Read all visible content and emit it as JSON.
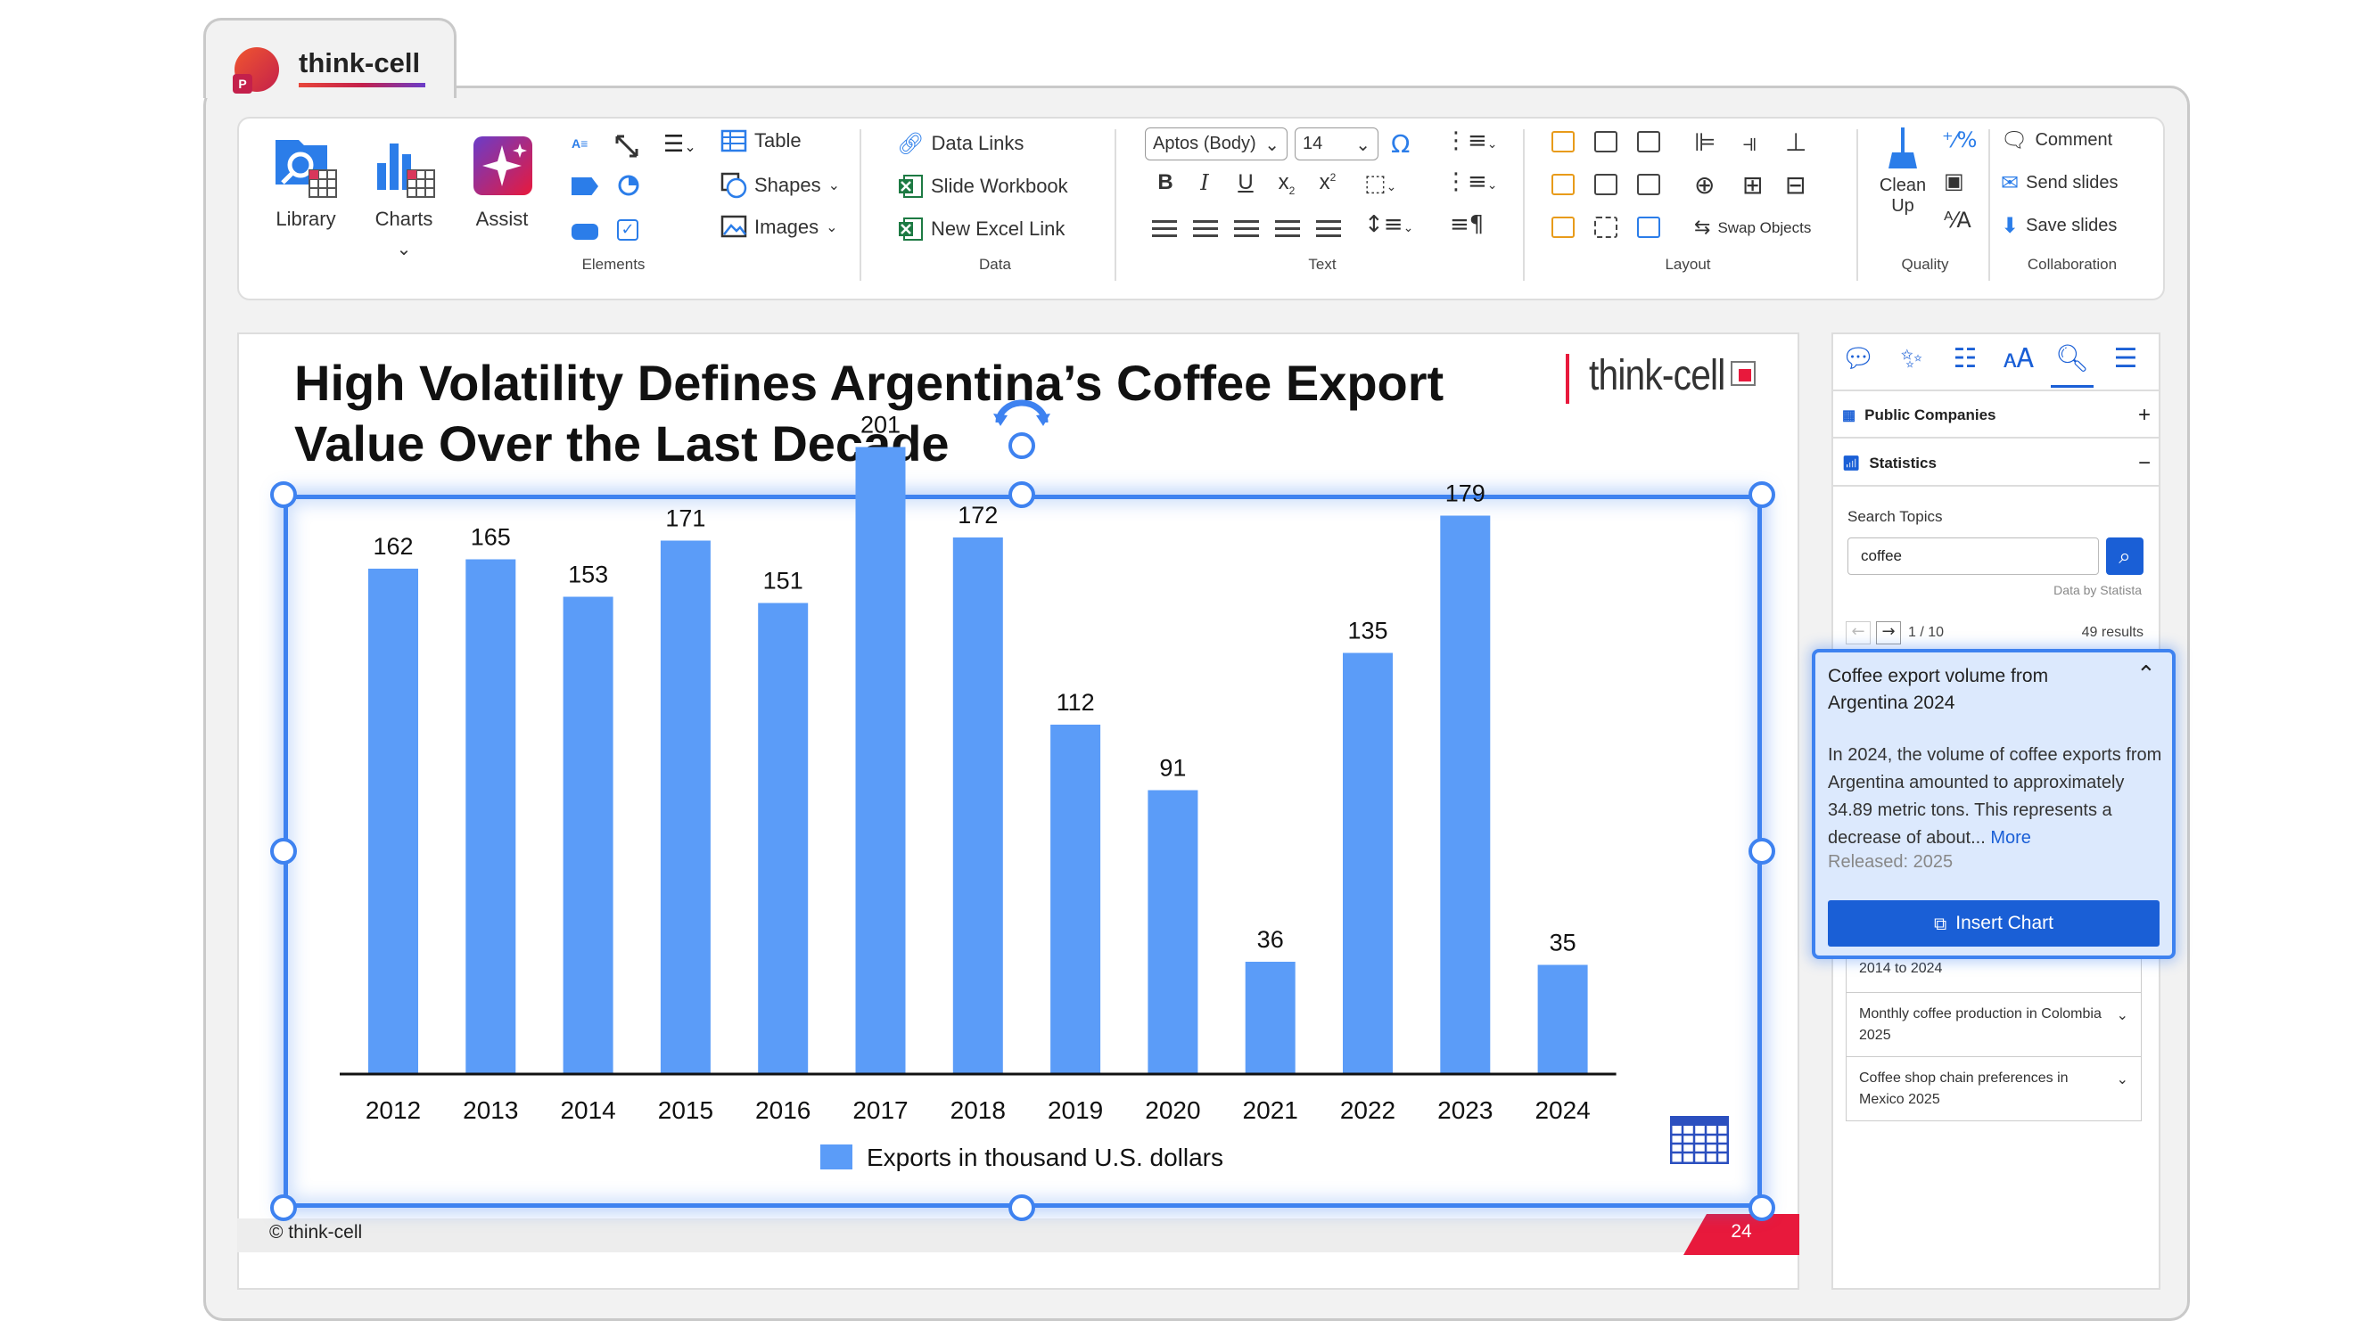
{
  "app": {
    "name": "think-cell"
  },
  "ribbon": {
    "library": "Library",
    "charts": "Charts",
    "assist": "Assist",
    "groups": {
      "elements": "Elements",
      "data": "Data",
      "text": "Text",
      "layout": "Layout",
      "quality": "Quality",
      "collaboration": "Collaboration"
    },
    "table": "Table",
    "shapes": "Shapes",
    "images": "Images",
    "data_links": "Data Links",
    "slide_workbook": "Slide Workbook",
    "new_excel_link": "New Excel Link",
    "font_name": "Aptos (Body)",
    "font_size": "14",
    "swap_objects": "Swap Objects",
    "clean_up": "Clean\nUp",
    "clean": "Clean",
    "up": "Up",
    "comment": "Comment",
    "send_slides": "Send slides",
    "save_slides": "Save slides",
    "bold": "B",
    "italic": "I",
    "underline": "U"
  },
  "slide": {
    "title_line1": "High Volatility Defines Argentina’s Coffee Export",
    "title_line2": "Value Over the Last Decade",
    "brand": "think-cell",
    "copyright": "© think-cell",
    "page_number": "24"
  },
  "chart_data": {
    "type": "bar",
    "categories": [
      "2012",
      "2013",
      "2014",
      "2015",
      "2016",
      "2017",
      "2018",
      "2019",
      "2020",
      "2021",
      "2022",
      "2023",
      "2024"
    ],
    "series": [
      {
        "name": "Exports in thousand U.S. dollars",
        "values": [
          162,
          165,
          153,
          171,
          151,
          201,
          172,
          112,
          91,
          36,
          135,
          179,
          35
        ],
        "color": "#5b9cf8"
      }
    ],
    "ylim": [
      0,
      220
    ],
    "legend": "bottom"
  },
  "pane": {
    "public_companies": "Public Companies",
    "statistics": "Statistics",
    "search_label": "Search Topics",
    "search_value": "coffee",
    "data_by": "Data by Statista",
    "pager": "1 / 10",
    "results": "49 results",
    "card": {
      "title": "Coffee export volume from Argentina 2024",
      "body": "In 2024, the volume of coffee exports from Argentina amounted to approximately 34.89 metric tons. This represents a decrease of about...",
      "more": "More",
      "released": "Released: 2025",
      "insert": "Insert Chart"
    },
    "items": [
      {
        "label": "2014 to 2024"
      },
      {
        "label": "Monthly coffee production in Colombia 2025"
      },
      {
        "label": "Coffee shop chain preferences in Mexico 2025"
      }
    ],
    "plus": "+",
    "minus": "−"
  },
  "colors": {
    "accent": "#1a5fd6",
    "bar": "#5b9cf8",
    "selection": "#3e82f0",
    "brand_red": "#e8193c"
  }
}
